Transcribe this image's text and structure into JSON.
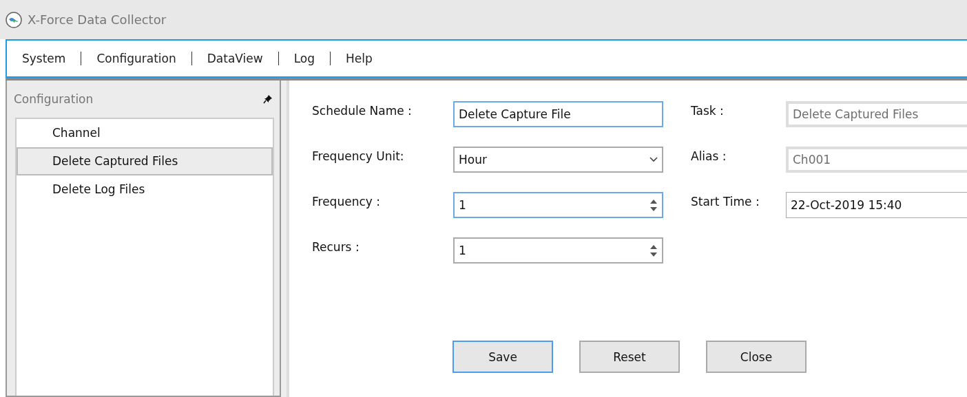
{
  "window": {
    "title": "X-Force Data Collector"
  },
  "menu": [
    {
      "label": "System"
    },
    {
      "label": "Configuration"
    },
    {
      "label": "DataView"
    },
    {
      "label": "Log"
    },
    {
      "label": "Help"
    }
  ],
  "sidebar": {
    "title": "Configuration",
    "items": [
      {
        "label": "Channel",
        "selected": false
      },
      {
        "label": "Delete Captured Files",
        "selected": true
      },
      {
        "label": "Delete Log Files",
        "selected": false
      }
    ]
  },
  "form": {
    "left": [
      {
        "label": "Schedule Name :",
        "kind": "text",
        "value": "Delete Capture File",
        "focused": true
      },
      {
        "label": "Frequency Unit:",
        "kind": "select",
        "value": "Hour",
        "focused": false
      },
      {
        "label": "Frequency :",
        "kind": "spin",
        "value": "1",
        "focused": true
      },
      {
        "label": "Recurs :",
        "kind": "spin",
        "value": "1",
        "focused": false
      }
    ],
    "right": [
      {
        "label": "Task :",
        "kind": "text",
        "value": "Delete Captured Files",
        "disabled": true
      },
      {
        "label": "Alias :",
        "kind": "text",
        "value": "Ch001",
        "disabled": true
      },
      {
        "label": "Start Time :",
        "kind": "date",
        "value": "22-Oct-2019 15:40",
        "disabled": false
      }
    ]
  },
  "buttons": [
    {
      "label": "Save",
      "focused": true
    },
    {
      "label": "Reset",
      "focused": false
    },
    {
      "label": "Close",
      "focused": false
    }
  ]
}
